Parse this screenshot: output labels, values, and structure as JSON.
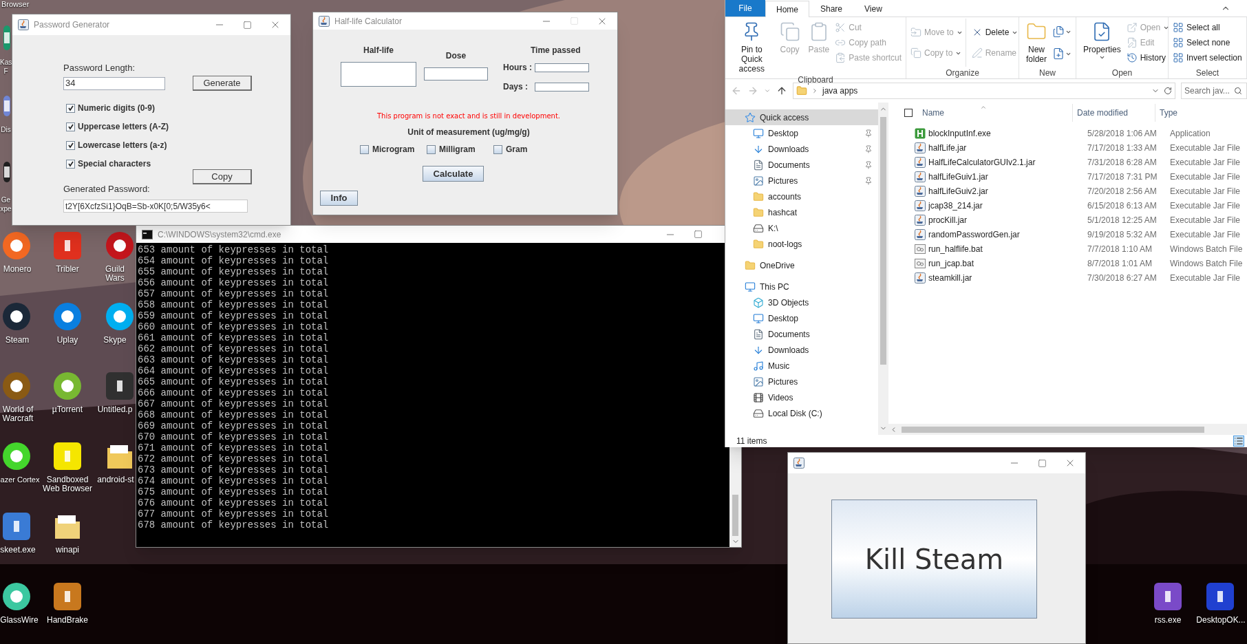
{
  "desktop_icons": [
    {
      "label": "Browser"
    },
    {
      "label": "Kas\nF"
    },
    {
      "label": "Dis"
    },
    {
      "label": "Ge\nxpe"
    },
    {
      "label": "Monero"
    },
    {
      "label": "Tribler"
    },
    {
      "label": "Guild Wars"
    },
    {
      "label": "Steam"
    },
    {
      "label": "Uplay"
    },
    {
      "label": "Skype"
    },
    {
      "label": "World of Warcraft"
    },
    {
      "label": "µTorrent"
    },
    {
      "label": "Untitled.p"
    },
    {
      "label": "azer Cortex"
    },
    {
      "label": "Sandboxed Web Browser"
    },
    {
      "label": "android-st"
    },
    {
      "label": "skeet.exe"
    },
    {
      "label": "winapi"
    },
    {
      "label": "GlassWire"
    },
    {
      "label": "HandBrake"
    },
    {
      "label": "rss.exe"
    },
    {
      "label": "DesktopOK..."
    }
  ],
  "password_generator": {
    "title": "Password Generator",
    "maximize_disabled": false,
    "length_label": "Password Length:",
    "length_value": "34",
    "generate_button": "Generate",
    "options": [
      {
        "label": "Numeric digits (0-9)",
        "checked": true
      },
      {
        "label": "Uppercase letters (A-Z)",
        "checked": true
      },
      {
        "label": "Lowercase letters (a-z)",
        "checked": true
      },
      {
        "label": "Special characters",
        "checked": true
      }
    ],
    "copy_button": "Copy",
    "output_label": "Generated Password:",
    "output_value": "t2Y[6XcfzSi1}OqB=Sb-x0K[0;5/W35y6<"
  },
  "half_life_calculator": {
    "title": "Half-life Calculator",
    "maximize_disabled": true,
    "half_life_label": "Half-life",
    "dose_label": "Dose",
    "time_label": "Time passed",
    "hours_label": "Hours :",
    "days_label": "Days :",
    "warning": "This program is not exact and is still in development.",
    "unit_label": "Unit of measurement (ug/mg/g)",
    "units": [
      {
        "label": "Microgram",
        "checked": false
      },
      {
        "label": "Milligram",
        "checked": false
      },
      {
        "label": "Gram",
        "checked": false
      }
    ],
    "calculate_button": "Calculate",
    "info_button": "Info"
  },
  "console": {
    "title": "C:\\WINDOWS\\system32\\cmd.exe",
    "lines": [
      "653 amount of keypresses in total",
      "654 amount of keypresses in total",
      "655 amount of keypresses in total",
      "656 amount of keypresses in total",
      "657 amount of keypresses in total",
      "658 amount of keypresses in total",
      "659 amount of keypresses in total",
      "660 amount of keypresses in total",
      "661 amount of keypresses in total",
      "662 amount of keypresses in total",
      "663 amount of keypresses in total",
      "664 amount of keypresses in total",
      "665 amount of keypresses in total",
      "666 amount of keypresses in total",
      "667 amount of keypresses in total",
      "668 amount of keypresses in total",
      "669 amount of keypresses in total",
      "670 amount of keypresses in total",
      "671 amount of keypresses in total",
      "672 amount of keypresses in total",
      "673 amount of keypresses in total",
      "674 amount of keypresses in total",
      "675 amount of keypresses in total",
      "676 amount of keypresses in total",
      "677 amount of keypresses in total",
      "678 amount of keypresses in total"
    ]
  },
  "explorer": {
    "tabs": [
      {
        "label": "File",
        "kind": "file",
        "selected": false
      },
      {
        "label": "Home",
        "kind": "tab",
        "selected": true
      },
      {
        "label": "Share",
        "kind": "tab",
        "selected": false
      },
      {
        "label": "View",
        "kind": "tab",
        "selected": false
      }
    ],
    "ribbon_groups": [
      {
        "label": "Clipboard",
        "columns": [
          [
            {
              "label": "Pin to Quick access",
              "kind": "large",
              "disabled": false,
              "menu": false
            }
          ],
          [
            {
              "label": "Copy",
              "kind": "large",
              "disabled": true,
              "menu": false
            }
          ],
          [
            {
              "label": "Paste",
              "kind": "large",
              "disabled": true,
              "menu": false
            }
          ],
          [
            {
              "label": "Cut",
              "kind": "small",
              "disabled": true,
              "menu": false
            },
            {
              "label": "Copy path",
              "kind": "small",
              "disabled": true,
              "menu": false
            },
            {
              "label": "Paste shortcut",
              "kind": "small",
              "disabled": true,
              "menu": false
            }
          ]
        ]
      },
      {
        "label": "Organize",
        "columns": [
          [
            {
              "label": "Move to",
              "kind": "small",
              "disabled": true,
              "menu": true
            },
            {
              "label": "Copy to",
              "kind": "small",
              "disabled": true,
              "menu": true
            }
          ],
          [
            {
              "label": "Delete",
              "kind": "small",
              "disabled": false,
              "menu": true
            },
            {
              "label": "Rename",
              "kind": "small",
              "disabled": true,
              "menu": false
            }
          ]
        ]
      },
      {
        "label": "New",
        "columns": [
          [
            {
              "label": "New folder",
              "kind": "large",
              "disabled": false,
              "menu": false
            }
          ],
          [
            {
              "kind": "icon_menu",
              "disabled": false,
              "menu": true
            },
            {
              "kind": "icon_menu",
              "disabled": false,
              "menu": true
            }
          ]
        ]
      },
      {
        "label": "Open",
        "columns": [
          [
            {
              "label": "Properties",
              "kind": "large",
              "disabled": false,
              "menu": true
            }
          ],
          [
            {
              "label": "Open",
              "kind": "small",
              "disabled": true,
              "menu": true
            },
            {
              "label": "Edit",
              "kind": "small",
              "disabled": true,
              "menu": false
            },
            {
              "label": "History",
              "kind": "small",
              "disabled": false,
              "menu": false
            }
          ]
        ]
      },
      {
        "label": "Select",
        "columns": [
          [
            {
              "label": "Select all",
              "kind": "small",
              "disabled": false,
              "menu": false
            },
            {
              "label": "Select none",
              "kind": "small",
              "disabled": false,
              "menu": false
            },
            {
              "label": "Invert selection",
              "kind": "small",
              "disabled": false,
              "menu": false
            }
          ]
        ]
      }
    ],
    "all_selected": false,
    "address": "java apps",
    "search_placeholder": "Search jav...",
    "nav": [
      {
        "label": "Quick access",
        "kind": "quick_access",
        "selected": true,
        "children": [
          {
            "label": "Desktop",
            "kind": "desktop",
            "pinned": true,
            "selected": false
          },
          {
            "label": "Downloads",
            "kind": "downloads",
            "pinned": true,
            "selected": false
          },
          {
            "label": "Documents",
            "kind": "documents",
            "pinned": true,
            "selected": false
          },
          {
            "label": "Pictures",
            "kind": "pictures",
            "pinned": true,
            "selected": false
          },
          {
            "label": "accounts",
            "kind": "folder",
            "pinned": false,
            "selected": false
          },
          {
            "label": "hashcat",
            "kind": "folder",
            "pinned": false,
            "selected": false
          },
          {
            "label": "K:\\",
            "kind": "drive",
            "pinned": false,
            "selected": false
          },
          {
            "label": "noot-logs",
            "kind": "folder",
            "pinned": false,
            "selected": false
          }
        ]
      },
      {
        "label": "OneDrive",
        "kind": "folder",
        "selected": false
      },
      {
        "label": "This PC",
        "kind": "pc",
        "selected": false,
        "children": [
          {
            "label": "3D Objects",
            "kind": "objects",
            "pinned": false,
            "selected": false
          },
          {
            "label": "Desktop",
            "kind": "desktop",
            "pinned": false,
            "selected": false
          },
          {
            "label": "Documents",
            "kind": "documents",
            "pinned": false,
            "selected": false
          },
          {
            "label": "Downloads",
            "kind": "downloads",
            "pinned": false,
            "selected": false
          },
          {
            "label": "Music",
            "kind": "music",
            "pinned": false,
            "selected": false
          },
          {
            "label": "Pictures",
            "kind": "pictures",
            "pinned": false,
            "selected": false
          },
          {
            "label": "Videos",
            "kind": "videos",
            "pinned": false,
            "selected": false
          },
          {
            "label": "Local Disk (C:)",
            "kind": "drive",
            "pinned": false,
            "selected": false
          }
        ]
      }
    ],
    "columns": [
      {
        "label": "Name",
        "sorted": true
      },
      {
        "label": "Date modified",
        "sorted": false
      },
      {
        "label": "Type",
        "sorted": false
      }
    ],
    "files": [
      {
        "name": "blockInputInf.exe",
        "date": "5/28/2018 1:06 AM",
        "type": "Application",
        "kind": "application"
      },
      {
        "name": "halfLife.jar",
        "date": "7/17/2018 1:33 AM",
        "type": "Executable Jar File",
        "kind": "jar"
      },
      {
        "name": "HalfLifeCalculatorGUIv2.1.jar",
        "date": "7/31/2018 6:28 AM",
        "type": "Executable Jar File",
        "kind": "jar"
      },
      {
        "name": "halfLifeGuiv1.jar",
        "date": "7/17/2018 7:31 PM",
        "type": "Executable Jar File",
        "kind": "jar"
      },
      {
        "name": "halfLifeGuiv2.jar",
        "date": "7/20/2018 2:56 AM",
        "type": "Executable Jar File",
        "kind": "jar"
      },
      {
        "name": "jcap38_214.jar",
        "date": "6/15/2018 6:13 AM",
        "type": "Executable Jar File",
        "kind": "jar"
      },
      {
        "name": "procKill.jar",
        "date": "5/1/2018 12:25 AM",
        "type": "Executable Jar File",
        "kind": "jar"
      },
      {
        "name": "randomPasswordGen.jar",
        "date": "9/19/2018 5:32 AM",
        "type": "Executable Jar File",
        "kind": "jar"
      },
      {
        "name": "run_halflife.bat",
        "date": "7/7/2018 1:10 AM",
        "type": "Windows Batch File",
        "kind": "batch"
      },
      {
        "name": "run_jcap.bat",
        "date": "8/7/2018 1:01 AM",
        "type": "Windows Batch File",
        "kind": "batch"
      },
      {
        "name": "steamkill.jar",
        "date": "7/30/2018 6:27 AM",
        "type": "Executable Jar File",
        "kind": "jar"
      }
    ],
    "status": "11 items"
  },
  "kill_steam": {
    "maximize_disabled": false,
    "button": "Kill Steam"
  }
}
